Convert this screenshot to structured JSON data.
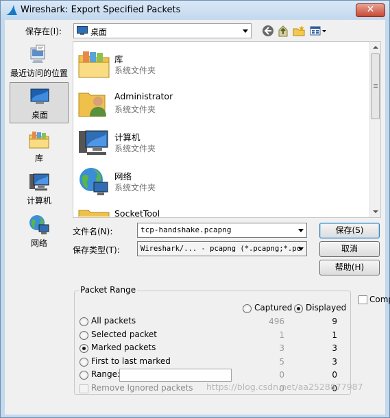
{
  "window": {
    "title": "Wireshark: Export Specified Packets",
    "close_label": "✕"
  },
  "toolbar": {
    "save_in_label": "保存在(I):",
    "save_in_value": "桌面"
  },
  "places": [
    {
      "label": "最近访问的位置",
      "icon": "recent-places-icon"
    },
    {
      "label": "桌面",
      "icon": "desktop-icon"
    },
    {
      "label": "库",
      "icon": "library-icon"
    },
    {
      "label": "计算机",
      "icon": "computer-icon"
    },
    {
      "label": "网络",
      "icon": "network-icon"
    }
  ],
  "files": [
    {
      "name": "库",
      "type": "系统文件夹",
      "icon": "library-folder-icon"
    },
    {
      "name": "Administrator",
      "type": "系统文件夹",
      "icon": "user-folder-icon"
    },
    {
      "name": "计算机",
      "type": "系统文件夹",
      "icon": "computer-icon"
    },
    {
      "name": "网络",
      "type": "系统文件夹",
      "icon": "network-icon"
    },
    {
      "name": "SocketTool",
      "type": "",
      "icon": "folder-icon"
    }
  ],
  "form": {
    "filename_label": "文件名(N):",
    "filename_value": "tcp-handshake.pcapng",
    "filetype_label": "保存类型(T):",
    "filetype_value": "Wireshark/... - pcapng (*.pcapng;*.pc"
  },
  "buttons": {
    "save": "保存(S)",
    "cancel": "取消",
    "help": "帮助(H)"
  },
  "compress_label": "Comp",
  "packet_range": {
    "title": "Packet Range",
    "captured_label": "Captured",
    "displayed_label": "Displayed",
    "selected_column": "Displayed",
    "selected_option": "Marked packets",
    "rows": [
      {
        "label": "All packets",
        "captured": "496",
        "displayed": "9"
      },
      {
        "label": "Selected packet",
        "captured": "1",
        "displayed": "1"
      },
      {
        "label": "Marked packets",
        "captured": "3",
        "displayed": "3"
      },
      {
        "label": "First to last marked",
        "captured": "5",
        "displayed": "3"
      },
      {
        "label": "Range:",
        "captured": "0",
        "displayed": "0"
      },
      {
        "label": "Remove Ignored packets",
        "captured": "0",
        "displayed": "0"
      }
    ]
  },
  "watermark": "https://blog.csdn.net/aa2528877987",
  "colors": {
    "accent": "#3c7fb1",
    "title_bar": "#c4d9ee",
    "close": "#c74a35"
  }
}
